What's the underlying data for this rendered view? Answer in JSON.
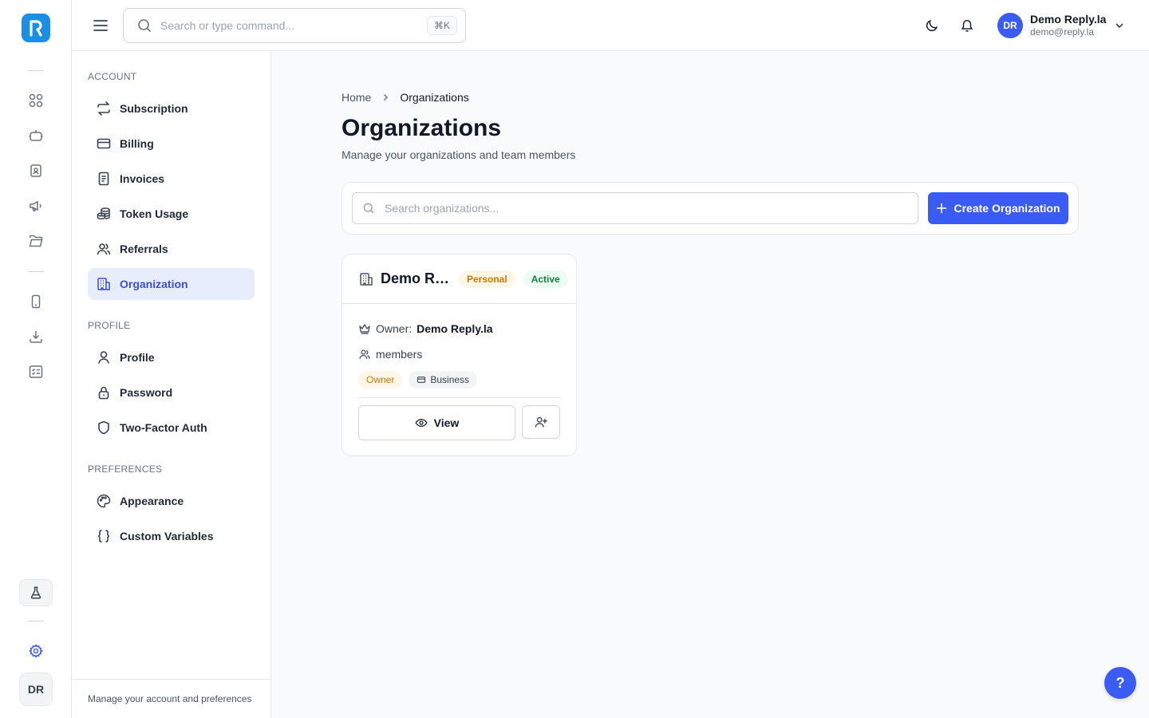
{
  "rail": {
    "logo_icon": "reply-logo-icon",
    "icons": [
      "apps-grid-icon",
      "bot-icon",
      "contacts-icon",
      "megaphone-icon",
      "folder-icon",
      "mobile-icon",
      "download-icon",
      "checklist-icon"
    ],
    "lab_icon": "flask-icon",
    "settings_icon": "gear-icon",
    "avatar_initials": "DR"
  },
  "topbar": {
    "search_placeholder": "Search or type command...",
    "shortcut": "⌘K",
    "theme_icon": "moon-icon",
    "notify_icon": "bell-icon",
    "user": {
      "initials": "DR",
      "name": "Demo Reply.la",
      "email": "demo@reply.la"
    }
  },
  "sidebar": {
    "sections": {
      "account": "ACCOUNT",
      "profile": "PROFILE",
      "preferences": "PREFERENCES"
    },
    "account_items": [
      {
        "label": "Subscription",
        "icon": "repeat-icon"
      },
      {
        "label": "Billing",
        "icon": "credit-card-icon"
      },
      {
        "label": "Invoices",
        "icon": "invoice-icon"
      },
      {
        "label": "Token Usage",
        "icon": "coins-icon"
      },
      {
        "label": "Referrals",
        "icon": "users-icon"
      },
      {
        "label": "Organization",
        "icon": "building-icon",
        "active": true
      }
    ],
    "profile_items": [
      {
        "label": "Profile",
        "icon": "user-icon"
      },
      {
        "label": "Password",
        "icon": "lock-icon"
      },
      {
        "label": "Two-Factor Auth",
        "icon": "shield-icon"
      }
    ],
    "preference_items": [
      {
        "label": "Appearance",
        "icon": "palette-icon"
      },
      {
        "label": "Custom Variables",
        "icon": "braces-icon"
      }
    ],
    "footer": "Manage your account and preferences"
  },
  "main": {
    "breadcrumb": {
      "home": "Home",
      "current": "Organizations"
    },
    "title": "Organizations",
    "subtitle": "Manage your organizations and team members",
    "search_placeholder": "Search organizations...",
    "create_label": "Create Organization",
    "accent": "#3b5bf5"
  },
  "org_card": {
    "name": "Demo Re...",
    "badge_type": "Personal",
    "badge_status": "Active",
    "owner_label": "Owner:",
    "owner_name": "Demo Reply.la",
    "members_label": "members",
    "role_chip": "Owner",
    "plan_chip": "Business",
    "view_label": "View"
  },
  "help": {
    "label": "?"
  }
}
